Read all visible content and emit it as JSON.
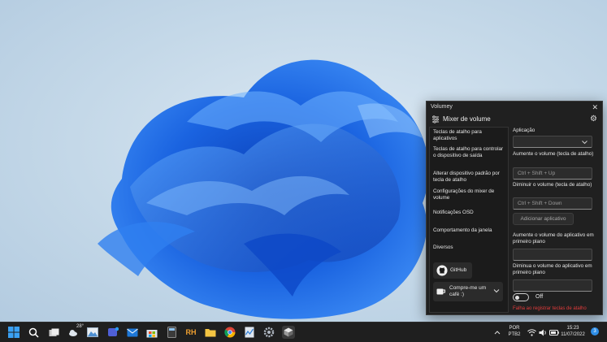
{
  "window": {
    "title": "Volumey",
    "header_title": "Mixer de volume",
    "nav": [
      {
        "label": "Teclas de atalho para aplicativos"
      },
      {
        "label": "Teclas de atalho para controlar o dispositivo de saída"
      },
      {
        "label": "Alterar dispositivo padrão por tecla de atalho"
      },
      {
        "label": "Configurações do mixer de volume"
      },
      {
        "label": "Notificações OSD"
      },
      {
        "label": "Comportamento da janela"
      },
      {
        "label": "Diversos"
      }
    ],
    "github_label": "GitHub",
    "coffee_label": "Compre-me um café :)"
  },
  "panel": {
    "app_label": "Aplicação",
    "app_value": "",
    "vol_up_label": "Aumente o volume (tecla de atalho)",
    "vol_up_placeholder": "Ctrl + Shift + Up",
    "vol_down_label": "Diminuir o volume (tecla de atalho)",
    "vol_down_placeholder": "Ctrl + Shift + Down",
    "add_button": "Adicionar aplicativo",
    "fg_up_label": "Aumente o volume do aplicativo em primeiro plano",
    "fg_up_value": "",
    "fg_down_label": "Diminua o volume do aplicativo em primeiro plano",
    "fg_down_value": "",
    "toggle_state": "Off",
    "warning": "Falha ao registrar teclas de atalho"
  },
  "taskbar": {
    "weather_temp": "28°",
    "lang_line1": "POR",
    "lang_line2": "PTB2",
    "time": "15:23",
    "date": "11/07/2022",
    "notification_count": "3"
  },
  "colors": {
    "accent": "#0078d4",
    "warning": "#e23b3b",
    "window_bg": "#202020",
    "taskbar_bg": "#1f1f1f"
  }
}
